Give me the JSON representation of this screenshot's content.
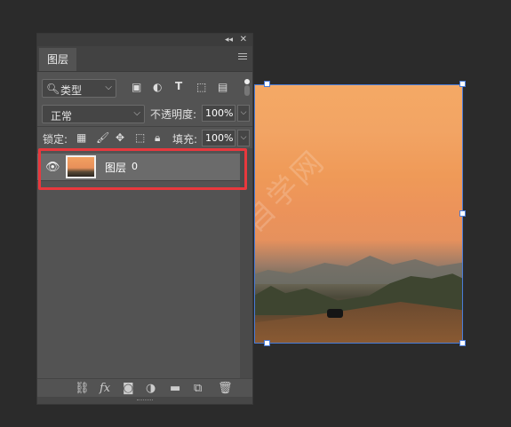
{
  "canvas": {
    "watermark": "软件自学网",
    "watermark_url": "RJZXW.COM"
  },
  "panel": {
    "title_icons": [
      "collapse-icon",
      "close-icon"
    ],
    "tab_label": "图层",
    "filter": {
      "value": "类型",
      "icons": [
        "image-filter-icon",
        "adjustment-filter-icon",
        "type-filter-icon",
        "shape-filter-icon",
        "smart-object-filter-icon"
      ]
    },
    "blend_mode": "正常",
    "opacity_label": "不透明度:",
    "opacity_value": "100%",
    "lock_label": "锁定:",
    "lock_icons": [
      "lock-transparent-pixels-icon",
      "lock-image-pixels-icon",
      "lock-position-icon",
      "lock-artboard-icon",
      "lock-all-icon"
    ],
    "fill_label": "填充:",
    "fill_value": "100%",
    "layers": [
      {
        "name": "图层",
        "suffix": "0",
        "visible": true,
        "selected": true
      }
    ],
    "footer_icons": [
      "link-layers-icon",
      "fx-icon",
      "add-mask-icon",
      "adjustment-layer-icon",
      "new-group-icon",
      "new-layer-icon",
      "delete-layer-icon"
    ]
  },
  "colors": {
    "highlight": "#e8383d",
    "selection_bbox": "#4a7cd8",
    "panel_bg": "#535353"
  }
}
